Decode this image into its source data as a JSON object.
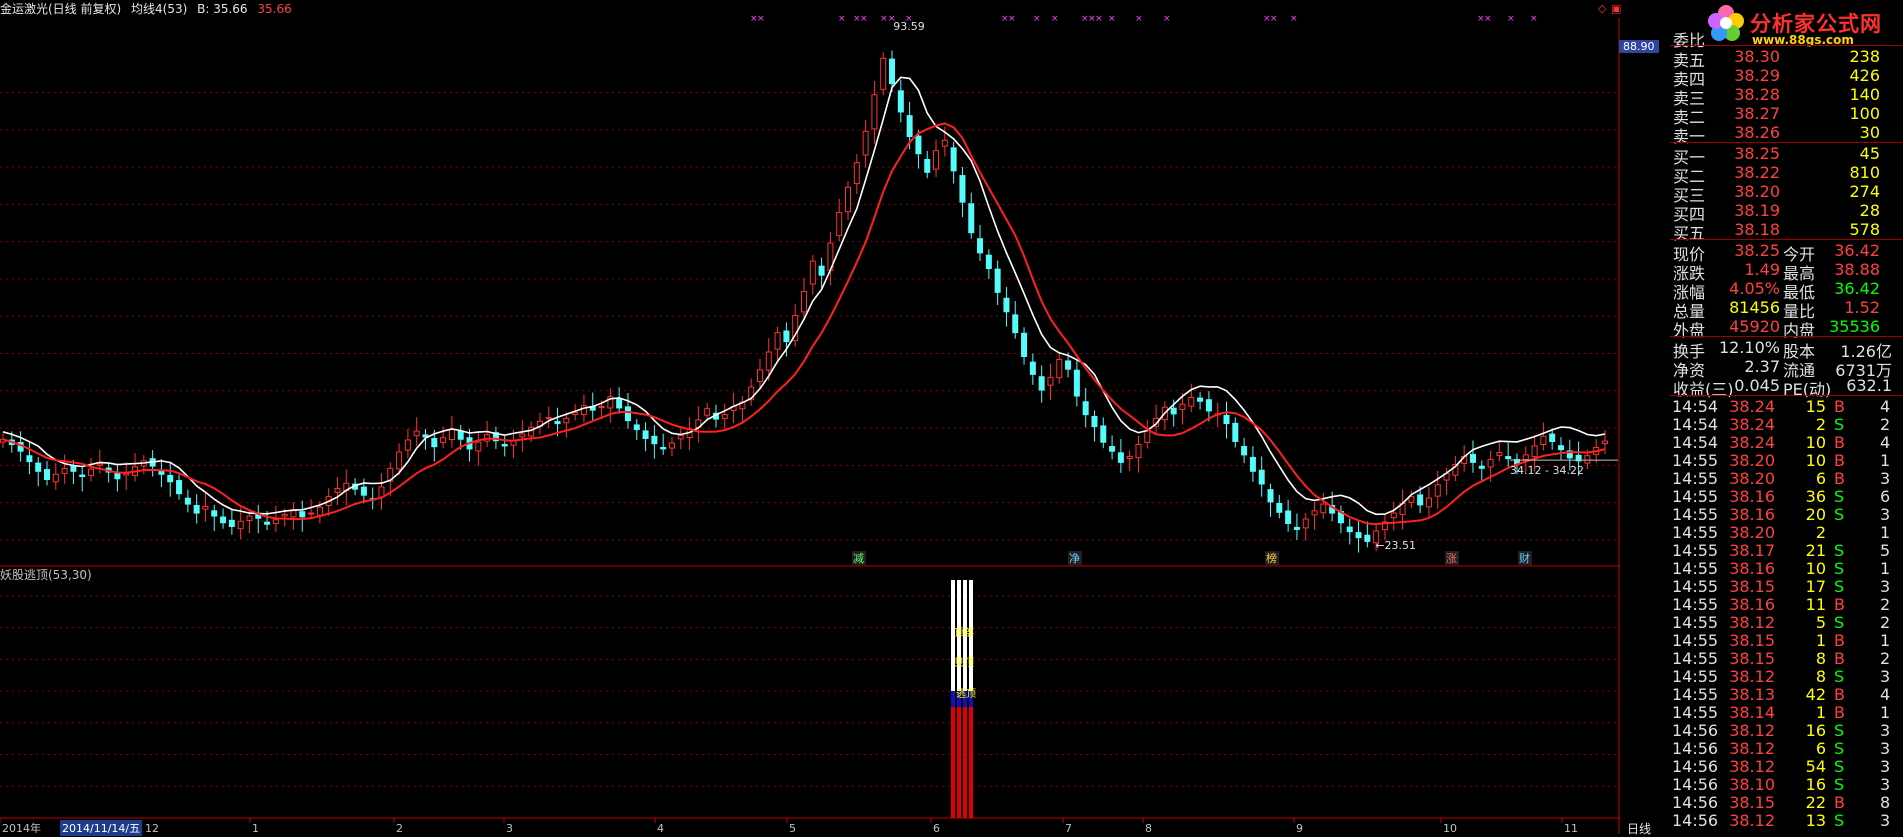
{
  "header": {
    "stock_name": "金运激光(日线 前复权)",
    "ma_label": "均线4(53)",
    "b_label": "B: 35.66",
    "b_value": "35.66"
  },
  "indicator": {
    "title": "妖股逃顶(53,30)",
    "labels": [
      "顶部",
      "见顶",
      "逃顶"
    ],
    "yaxis_ticks": [
      "14.00",
      "12.00",
      "10.00",
      "8.00",
      "6.00",
      "4.00",
      "2.00"
    ]
  },
  "chart_data": [
    {
      "type": "candlestick",
      "title": "",
      "yaxis_ticks": [
        "85.00",
        "80.00",
        "75.00",
        "70.00",
        "65.00",
        "60.00",
        "55.00",
        "50.00",
        "45.00",
        "40.00",
        "35.00",
        "30.00",
        "25.00"
      ],
      "ylim": [
        21.5,
        95
      ],
      "current_price_label": "88.90",
      "annotations": {
        "high": "93.59",
        "low": "23.51",
        "range": "34.12 - 34.22"
      },
      "x_labels": [
        "2014年",
        "12",
        "1",
        "2",
        "3",
        "4",
        "5",
        "6",
        "7",
        "8",
        "9",
        "10",
        "11"
      ],
      "event_tags": [
        "减",
        "净",
        "榜",
        "涨",
        "财"
      ],
      "closes": [
        38.5,
        37.8,
        36.9,
        35.5,
        34.2,
        33.1,
        33.8,
        34.6,
        34.2,
        33.5,
        34.5,
        35.2,
        34.1,
        33.2,
        33.9,
        34.8,
        35.6,
        34.9,
        33.8,
        32.8,
        31.2,
        29.8,
        28.6,
        29.5,
        28.2,
        27.3,
        26.8,
        27.5,
        28.2,
        27.9,
        27.1,
        27.7,
        28.4,
        28.9,
        28.1,
        28.6,
        29.4,
        30.8,
        31.9,
        32.6,
        31.8,
        31.0,
        30.5,
        32.1,
        34.6,
        36.8,
        38.4,
        39.6,
        38.8,
        37.5,
        38.7,
        39.8,
        38.5,
        37.2,
        38.1,
        39.1,
        38.3,
        37.6,
        38.3,
        39.2,
        40.1,
        40.9,
        41.4,
        40.6,
        41.3,
        42.1,
        43.0,
        42.4,
        42.9,
        44.2,
        42.7,
        41.0,
        39.8,
        38.6,
        37.9,
        37.2,
        38.0,
        39.0,
        39.9,
        41.1,
        42.6,
        41.2,
        41.8,
        42.9,
        43.5,
        45.5,
        47.8,
        50.2,
        52.8,
        51.6,
        55.1,
        58.3,
        62.4,
        60.5,
        64.8,
        68.9,
        72.3,
        75.6,
        79.8,
        84.7,
        89.6,
        86.2,
        82.4,
        79.1,
        76.8,
        74.3,
        77.2,
        78.6,
        74.5,
        70.3,
        66.2,
        63.5,
        61.4,
        58.2,
        55.6,
        52.8,
        49.6,
        47.2,
        45.1,
        46.8,
        49.2,
        47.9,
        44.3,
        41.8,
        40.2,
        38.1,
        36.9,
        35.4,
        36.2,
        37.8,
        39.6,
        41.3,
        42.8,
        41.9,
        43.2,
        44.1,
        43.6,
        42.3,
        41.9,
        40.6,
        38.2,
        36.4,
        34.2,
        32.5,
        30.1,
        28.7,
        27.2,
        26.4,
        27.8,
        28.9,
        29.8,
        28.6,
        27.3,
        26.1,
        25.3,
        24.8,
        26.2,
        27.4,
        28.6,
        29.9,
        30.8,
        29.7,
        30.6,
        32.4,
        33.9,
        35.1,
        36.2,
        35.4,
        34.6,
        35.8,
        36.7,
        35.9,
        35.2,
        36.4,
        37.6,
        38.9,
        38.2,
        37.1,
        36.0,
        35.6,
        36.3,
        37.4,
        38.25
      ],
      "ma_fast": "white",
      "ma_slow": "red"
    },
    {
      "type": "bar",
      "title": "",
      "ylim": [
        0,
        15
      ],
      "series": [
        {
          "values": [
            15,
            15,
            15,
            15
          ]
        },
        {
          "values": [
            8,
            8,
            8,
            8
          ]
        },
        {
          "values": [
            7,
            7,
            7,
            7
          ]
        }
      ]
    }
  ],
  "markers": {
    "pink_top": "× ×"
  },
  "side_panel": {
    "weibi_label": "委比",
    "weibi_value": "",
    "asks": [
      {
        "label": "卖五",
        "price": "38.30",
        "vol": "238"
      },
      {
        "label": "卖四",
        "price": "38.29",
        "vol": "426"
      },
      {
        "label": "卖三",
        "price": "38.28",
        "vol": "140"
      },
      {
        "label": "卖二",
        "price": "38.27",
        "vol": "100"
      },
      {
        "label": "卖一",
        "price": "38.26",
        "vol": "30"
      }
    ],
    "bids": [
      {
        "label": "买一",
        "price": "38.25",
        "vol": "45"
      },
      {
        "label": "买二",
        "price": "38.22",
        "vol": "810"
      },
      {
        "label": "买三",
        "price": "38.20",
        "vol": "274"
      },
      {
        "label": "买四",
        "price": "38.19",
        "vol": "28"
      },
      {
        "label": "买五",
        "price": "38.18",
        "vol": "578"
      }
    ],
    "quote": [
      {
        "l1": "现价",
        "v1": "38.25",
        "l2": "今开",
        "v2": "36.42"
      },
      {
        "l1": "涨跌",
        "v1": "1.49",
        "l2": "最高",
        "v2": "38.88"
      },
      {
        "l1": "涨幅",
        "v1": "4.05%",
        "l2": "最低",
        "v2": "36.42"
      },
      {
        "l1": "总量",
        "v1": "81456",
        "l2": "量比",
        "v2": "1.52"
      },
      {
        "l1": "外盘",
        "v1": "45920",
        "l2": "内盘",
        "v2": "35536"
      }
    ],
    "fundamentals": [
      {
        "l1": "换手",
        "v1": "12.10%",
        "l2": "股本",
        "v2": "1.26亿"
      },
      {
        "l1": "净资",
        "v1": "2.37",
        "l2": "流通",
        "v2": "6731万"
      },
      {
        "l1": "收益(三)",
        "v1": "0.045",
        "l2": "PE(动)",
        "v2": "632.1"
      }
    ],
    "ticks": [
      {
        "time": "14:54",
        "price": "38.24",
        "vol": "15",
        "side": "B",
        "n": "4"
      },
      {
        "time": "14:54",
        "price": "38.24",
        "vol": "2",
        "side": "S",
        "n": "2"
      },
      {
        "time": "14:54",
        "price": "38.24",
        "vol": "10",
        "side": "B",
        "n": "4"
      },
      {
        "time": "14:55",
        "price": "38.20",
        "vol": "10",
        "side": "B",
        "n": "1"
      },
      {
        "time": "14:55",
        "price": "38.20",
        "vol": "6",
        "side": "B",
        "n": "3"
      },
      {
        "time": "14:55",
        "price": "38.16",
        "vol": "36",
        "side": "S",
        "n": "6"
      },
      {
        "time": "14:55",
        "price": "38.16",
        "vol": "20",
        "side": "S",
        "n": "3"
      },
      {
        "time": "14:55",
        "price": "38.20",
        "vol": "2",
        "side": "",
        "n": "1"
      },
      {
        "time": "14:55",
        "price": "38.17",
        "vol": "21",
        "side": "S",
        "n": "5"
      },
      {
        "time": "14:55",
        "price": "38.16",
        "vol": "10",
        "side": "S",
        "n": "1"
      },
      {
        "time": "14:55",
        "price": "38.15",
        "vol": "17",
        "side": "S",
        "n": "3"
      },
      {
        "time": "14:55",
        "price": "38.16",
        "vol": "11",
        "side": "B",
        "n": "2"
      },
      {
        "time": "14:55",
        "price": "38.12",
        "vol": "5",
        "side": "S",
        "n": "2"
      },
      {
        "time": "14:55",
        "price": "38.15",
        "vol": "1",
        "side": "B",
        "n": "1"
      },
      {
        "time": "14:55",
        "price": "38.15",
        "vol": "8",
        "side": "B",
        "n": "2"
      },
      {
        "time": "14:55",
        "price": "38.12",
        "vol": "8",
        "side": "S",
        "n": "3"
      },
      {
        "time": "14:55",
        "price": "38.13",
        "vol": "42",
        "side": "B",
        "n": "4"
      },
      {
        "time": "14:55",
        "price": "38.14",
        "vol": "1",
        "side": "B",
        "n": "1"
      },
      {
        "time": "14:56",
        "price": "38.12",
        "vol": "16",
        "side": "S",
        "n": "3"
      },
      {
        "time": "14:56",
        "price": "38.12",
        "vol": "6",
        "side": "S",
        "n": "3"
      },
      {
        "time": "14:56",
        "price": "38.12",
        "vol": "54",
        "side": "S",
        "n": "3"
      },
      {
        "time": "14:56",
        "price": "38.10",
        "vol": "16",
        "side": "S",
        "n": "3"
      },
      {
        "time": "14:56",
        "price": "38.15",
        "vol": "22",
        "side": "B",
        "n": "8"
      },
      {
        "time": "14:56",
        "price": "38.12",
        "vol": "13",
        "side": "S",
        "n": "3"
      }
    ]
  },
  "logo": {
    "name": "分析家公式网",
    "url": "www.88gs.com"
  },
  "footer": {
    "date_cursor": "2014/11/14/五",
    "period": "日线"
  },
  "colors": {
    "up": "#ff3232",
    "down": "#54fcfc",
    "ma_fast": "#ffffff",
    "ma_slow": "#ff2020",
    "grid": "#800000",
    "axis": "#c00000"
  }
}
